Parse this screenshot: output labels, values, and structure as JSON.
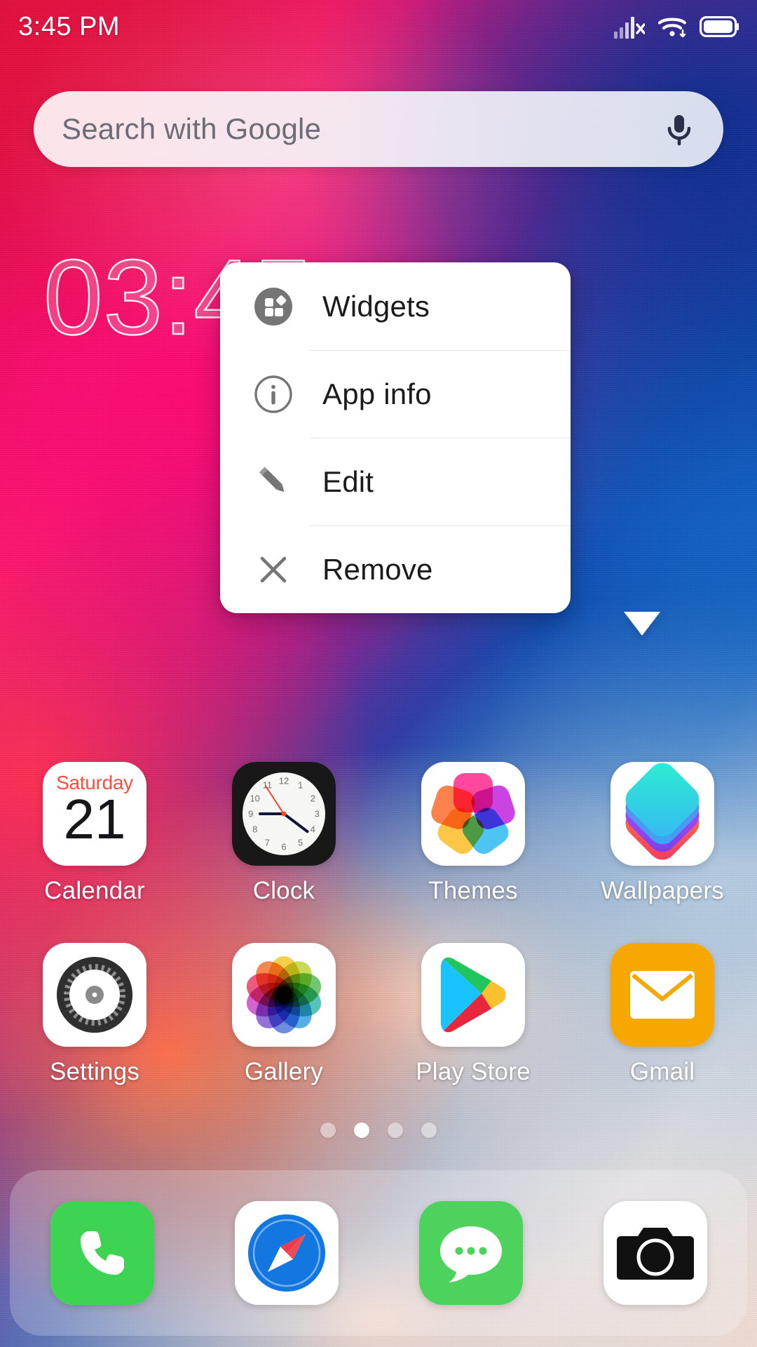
{
  "status_bar": {
    "time": "3:45 PM",
    "icons": [
      {
        "name": "signal-no-sim-icon",
        "label": "Cellular signal, no SIM"
      },
      {
        "name": "wifi-icon",
        "label": "Wi-Fi connected"
      },
      {
        "name": "battery-icon",
        "label": "Battery full"
      }
    ]
  },
  "search": {
    "placeholder": "Search with Google",
    "mic_icon": "microphone-icon",
    "mic_color": "#2b2f49"
  },
  "clock_widget": {
    "time": "03:45",
    "hours": "03",
    "minutes": "45",
    "separator": ":"
  },
  "popup_menu": {
    "items": [
      {
        "label": "Widgets",
        "icon": "widgets-icon"
      },
      {
        "label": "App info",
        "icon": "info-circle-icon"
      },
      {
        "label": "Edit",
        "icon": "pencil-edit-icon"
      },
      {
        "label": "Remove",
        "icon": "close-x-icon"
      }
    ],
    "anchor_app": "Wallpapers",
    "background": "#ffffff",
    "icon_color": "#757575",
    "text_color": "#1b1b1b"
  },
  "app_grid": {
    "rows": [
      [
        {
          "label": "Calendar",
          "icon": "calendar-icon",
          "cal_day": "Saturday",
          "cal_date": "21"
        },
        {
          "label": "Clock",
          "icon": "clock-icon"
        },
        {
          "label": "Themes",
          "icon": "themes-icon"
        },
        {
          "label": "Wallpapers",
          "icon": "wallpapers-icon"
        }
      ],
      [
        {
          "label": "Settings",
          "icon": "settings-gear-icon"
        },
        {
          "label": "Gallery",
          "icon": "gallery-photos-icon"
        },
        {
          "label": "Play Store",
          "icon": "play-store-icon"
        },
        {
          "label": "Gmail",
          "icon": "gmail-envelope-icon"
        }
      ]
    ],
    "clock_icon_numbers": [
      "12",
      "1",
      "2",
      "3",
      "4",
      "5",
      "6",
      "7",
      "8",
      "9",
      "10",
      "11"
    ]
  },
  "page_indicator": {
    "total": 4,
    "active_index": 1
  },
  "dock": {
    "items": [
      {
        "label": "Phone",
        "icon": "phone-handset-icon",
        "color": "#3fd353"
      },
      {
        "label": "Browser",
        "icon": "safari-compass-icon",
        "color": "#1b7ced"
      },
      {
        "label": "Messages",
        "icon": "message-bubble-icon",
        "color": "#4ed25e"
      },
      {
        "label": "Camera",
        "icon": "camera-icon",
        "color": "#111111"
      }
    ]
  },
  "colors": {
    "accent_pink": "#ff1478",
    "accent_blue": "#1046ae",
    "popup_bg": "#ffffff",
    "label_text": "#ffffff"
  }
}
